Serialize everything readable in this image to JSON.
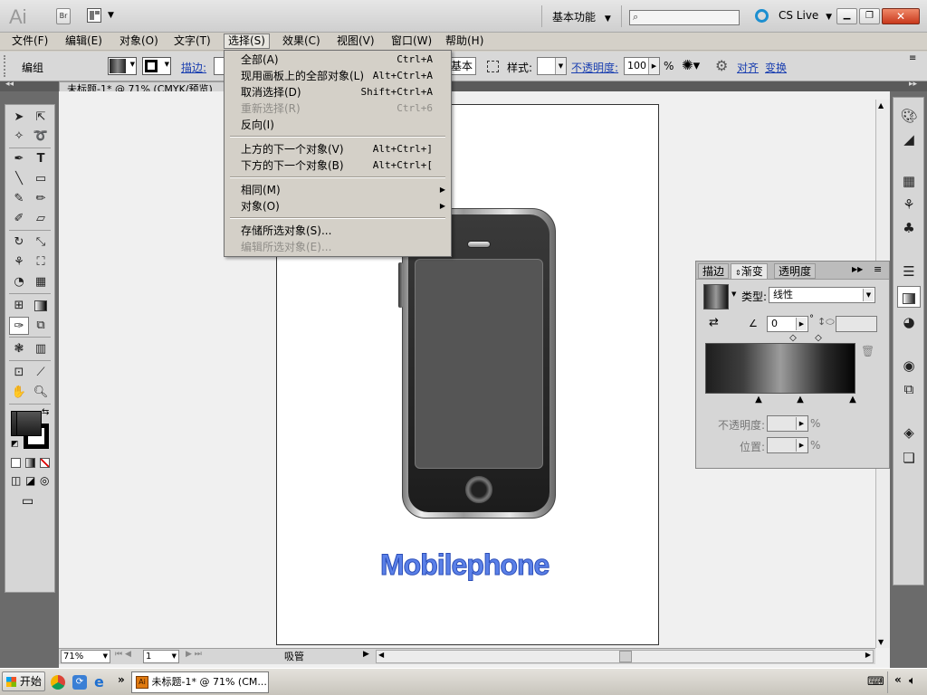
{
  "app": {
    "logo": "Ai",
    "bridge": "Br"
  },
  "workspace": {
    "label": "基本功能"
  },
  "cslive": {
    "label": "CS Live"
  },
  "search": {
    "placeholder": ""
  },
  "menu": [
    "文件(F)",
    "编辑(E)",
    "对象(O)",
    "文字(T)",
    "选择(S)",
    "效果(C)",
    "视图(V)",
    "窗口(W)",
    "帮助(H)"
  ],
  "control": {
    "selection": "编组",
    "stroke_link": "描边:",
    "basic": "基本",
    "style_label": "样式:",
    "opacity_link": "不透明度:",
    "opacity_value": "100",
    "opacity_unit": "%",
    "align_link": "对齐",
    "transform_link": "变换"
  },
  "document": {
    "tab": "未标题-1* @ 71% (CMYK/预览)"
  },
  "artwork": {
    "text": "Mobilephone"
  },
  "select_menu": {
    "items": [
      {
        "label": "全部(A)",
        "shortcut": "Ctrl+A",
        "enabled": true
      },
      {
        "label": "现用画板上的全部对象(L)",
        "shortcut": "Alt+Ctrl+A",
        "enabled": true
      },
      {
        "label": "取消选择(D)",
        "shortcut": "Shift+Ctrl+A",
        "enabled": true
      },
      {
        "label": "重新选择(R)",
        "shortcut": "Ctrl+6",
        "enabled": false
      },
      {
        "label": "反向(I)",
        "shortcut": "",
        "enabled": true
      },
      {
        "label": "上方的下一个对象(V)",
        "shortcut": "Alt+Ctrl+]",
        "enabled": true
      },
      {
        "label": "下方的下一个对象(B)",
        "shortcut": "Alt+Ctrl+[",
        "enabled": true
      },
      {
        "label": "相同(M)",
        "shortcut": "",
        "enabled": true,
        "submenu": true
      },
      {
        "label": "对象(O)",
        "shortcut": "",
        "enabled": true,
        "submenu": true
      },
      {
        "label": "存储所选对象(S)...",
        "shortcut": "",
        "enabled": true
      },
      {
        "label": "编辑所选对象(E)...",
        "shortcut": "",
        "enabled": false
      }
    ]
  },
  "gradient_panel": {
    "tabs": [
      "描边",
      "渐变",
      "透明度"
    ],
    "type_label": "类型:",
    "type_value": "线性",
    "angle_value": "0",
    "angle_unit": "°",
    "opacity_label": "不透明度:",
    "position_label": "位置:",
    "percent": "%"
  },
  "status": {
    "zoom": "71%",
    "artboard": "1",
    "tool": "吸管"
  },
  "taskbar": {
    "start": "开始",
    "task": "未标题-1* @ 71% (CM...",
    "chevron": "»",
    "tray_chevron": "«"
  },
  "colors": {
    "accent_link": "#1a3fb0",
    "art_text": "#5a80e8",
    "menu_bg": "#d4d0c8"
  }
}
